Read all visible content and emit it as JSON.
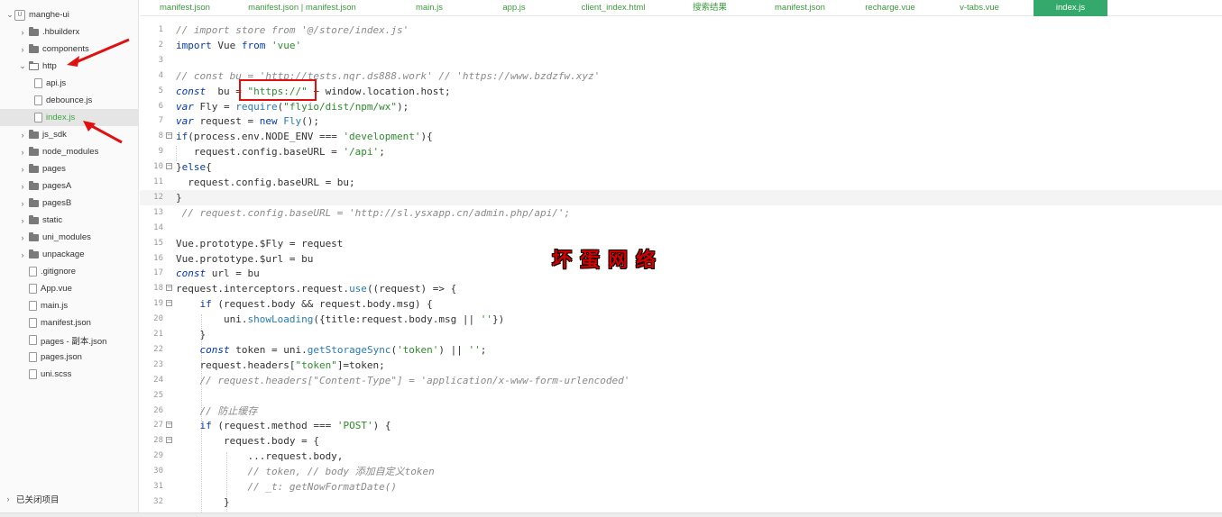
{
  "sidebar": {
    "items": [
      {
        "label": "manghe-ui",
        "type": "root",
        "chev": "⌄",
        "depth": 0
      },
      {
        "label": ".hbuilderx",
        "type": "folder",
        "chev": "›",
        "depth": 1
      },
      {
        "label": "components",
        "type": "folder",
        "chev": "›",
        "depth": 1
      },
      {
        "label": "http",
        "type": "folder-open",
        "chev": "⌄",
        "depth": 1
      },
      {
        "label": "api.js",
        "type": "file",
        "chev": "",
        "depth": 2
      },
      {
        "label": "debounce.js",
        "type": "file",
        "chev": "",
        "depth": 2
      },
      {
        "label": "index.js",
        "type": "file",
        "chev": "",
        "depth": 2,
        "active": true
      },
      {
        "label": "js_sdk",
        "type": "folder",
        "chev": "›",
        "depth": 1
      },
      {
        "label": "node_modules",
        "type": "folder",
        "chev": "›",
        "depth": 1
      },
      {
        "label": "pages",
        "type": "folder",
        "chev": "›",
        "depth": 1
      },
      {
        "label": "pagesA",
        "type": "folder",
        "chev": "›",
        "depth": 1
      },
      {
        "label": "pagesB",
        "type": "folder",
        "chev": "›",
        "depth": 1
      },
      {
        "label": "static",
        "type": "folder",
        "chev": "›",
        "depth": 1
      },
      {
        "label": "uni_modules",
        "type": "folder",
        "chev": "›",
        "depth": 1
      },
      {
        "label": "unpackage",
        "type": "folder",
        "chev": "›",
        "depth": 1
      },
      {
        "label": ".gitignore",
        "type": "file",
        "chev": "",
        "depth": 1
      },
      {
        "label": "App.vue",
        "type": "file",
        "chev": "",
        "depth": 1
      },
      {
        "label": "main.js",
        "type": "file",
        "chev": "",
        "depth": 1
      },
      {
        "label": "manifest.json",
        "type": "file",
        "chev": "",
        "depth": 1
      },
      {
        "label": "pages - 副本.json",
        "type": "file",
        "chev": "",
        "depth": 1
      },
      {
        "label": "pages.json",
        "type": "file",
        "chev": "",
        "depth": 1
      },
      {
        "label": "uni.scss",
        "type": "file",
        "chev": "",
        "depth": 1
      }
    ],
    "footer": "已关闭项目"
  },
  "tabs": [
    {
      "label": "manifest.json"
    },
    {
      "label": "manifest.json | manifest.json"
    },
    {
      "label": "main.js"
    },
    {
      "label": "app.js"
    },
    {
      "label": "client_index.html"
    },
    {
      "label": "搜索结果"
    },
    {
      "label": "manifest.json"
    },
    {
      "label": "recharge.vue"
    },
    {
      "label": "v-tabs.vue"
    },
    {
      "label": "index.js",
      "active": true
    }
  ],
  "watermark": "坏蛋网络",
  "code": {
    "lines": [
      {
        "n": "1",
        "fold": "",
        "tokens": [
          [
            "cm",
            "// import store from '@/store/index.js'"
          ]
        ]
      },
      {
        "n": "2",
        "fold": "",
        "tokens": [
          [
            "kw2",
            "import"
          ],
          [
            "",
            " Vue "
          ],
          [
            "kw2",
            "from"
          ],
          [
            "",
            " "
          ],
          [
            "str",
            "'vue'"
          ]
        ]
      },
      {
        "n": "3",
        "fold": "",
        "tokens": []
      },
      {
        "n": "4",
        "fold": "",
        "tokens": [
          [
            "cm",
            "// const bu = 'http://tests.nqr.ds888.work' // 'https://www.bzdzfw.xyz'"
          ]
        ]
      },
      {
        "n": "5",
        "fold": "",
        "tokens": [
          [
            "kw",
            "const"
          ],
          [
            "",
            "  bu = "
          ],
          [
            "str",
            "\"https://\""
          ],
          [
            "",
            " + window.location.host;"
          ]
        ]
      },
      {
        "n": "6",
        "fold": "",
        "tokens": [
          [
            "kw",
            "var"
          ],
          [
            "",
            " Fly = "
          ],
          [
            "fn",
            "require"
          ],
          [
            "",
            "("
          ],
          [
            "str",
            "\"flyio/dist/npm/wx\""
          ],
          [
            "",
            ");"
          ]
        ]
      },
      {
        "n": "7",
        "fold": "",
        "tokens": [
          [
            "kw",
            "var"
          ],
          [
            "",
            " request = "
          ],
          [
            "kw2",
            "new"
          ],
          [
            "",
            " "
          ],
          [
            "fn",
            "Fly"
          ],
          [
            "",
            "();"
          ]
        ]
      },
      {
        "n": "8",
        "fold": "−",
        "tokens": [
          [
            "kw2",
            "if"
          ],
          [
            "",
            "(process.env.NODE_ENV === "
          ],
          [
            "str",
            "'development'"
          ],
          [
            "",
            "){"
          ]
        ]
      },
      {
        "n": "9",
        "fold": "",
        "tokens": [
          [
            "",
            "   request.config.baseURL = "
          ],
          [
            "str",
            "'/api'"
          ],
          [
            "",
            ";"
          ]
        ]
      },
      {
        "n": "10",
        "fold": "−",
        "tokens": [
          [
            "",
            "}"
          ],
          [
            "kw2",
            "else"
          ],
          [
            "",
            "{"
          ]
        ]
      },
      {
        "n": "11",
        "fold": "",
        "tokens": [
          [
            "",
            "  request.config.baseURL = bu;"
          ]
        ]
      },
      {
        "n": "12",
        "fold": "",
        "tokens": [
          [
            "",
            "}"
          ]
        ],
        "hl": true
      },
      {
        "n": "13",
        "fold": "",
        "tokens": [
          [
            "cm",
            " // request.config.baseURL = 'http://sl.ysxapp.cn/admin.php/api/';"
          ]
        ]
      },
      {
        "n": "14",
        "fold": "",
        "tokens": []
      },
      {
        "n": "15",
        "fold": "",
        "tokens": [
          [
            "",
            "Vue.prototype.$Fly = request"
          ]
        ]
      },
      {
        "n": "16",
        "fold": "",
        "tokens": [
          [
            "",
            "Vue.prototype.$url = bu"
          ]
        ]
      },
      {
        "n": "17",
        "fold": "",
        "tokens": [
          [
            "kw",
            "const"
          ],
          [
            "",
            " url = bu"
          ]
        ]
      },
      {
        "n": "18",
        "fold": "−",
        "tokens": [
          [
            "",
            "request.interceptors.request."
          ],
          [
            "fn",
            "use"
          ],
          [
            "",
            "((request) => {"
          ]
        ]
      },
      {
        "n": "19",
        "fold": "−",
        "tokens": [
          [
            "",
            "    "
          ],
          [
            "kw2",
            "if"
          ],
          [
            "",
            " (request.body && request.body.msg) {"
          ]
        ]
      },
      {
        "n": "20",
        "fold": "",
        "tokens": [
          [
            "",
            "        uni."
          ],
          [
            "fn",
            "showLoading"
          ],
          [
            "",
            "({title:request.body.msg || "
          ],
          [
            "str",
            "''"
          ],
          [
            "",
            "})"
          ]
        ]
      },
      {
        "n": "21",
        "fold": "",
        "tokens": [
          [
            "",
            "    }"
          ]
        ]
      },
      {
        "n": "22",
        "fold": "",
        "tokens": [
          [
            "",
            "    "
          ],
          [
            "kw",
            "const"
          ],
          [
            "",
            " token = uni."
          ],
          [
            "fn",
            "getStorageSync"
          ],
          [
            "",
            "("
          ],
          [
            "str",
            "'token'"
          ],
          [
            "",
            ") || "
          ],
          [
            "str",
            "''"
          ],
          [
            "",
            ";"
          ]
        ]
      },
      {
        "n": "23",
        "fold": "",
        "tokens": [
          [
            "",
            "    request.headers["
          ],
          [
            "str",
            "\"token\""
          ],
          [
            "",
            "]=token;"
          ]
        ]
      },
      {
        "n": "24",
        "fold": "",
        "tokens": [
          [
            "cm",
            "    // request.headers[\"Content-Type\"] = 'application/x-www-form-urlencoded'"
          ]
        ]
      },
      {
        "n": "25",
        "fold": "",
        "tokens": []
      },
      {
        "n": "26",
        "fold": "",
        "tokens": [
          [
            "cm",
            "    // 防止缓存"
          ]
        ]
      },
      {
        "n": "27",
        "fold": "−",
        "tokens": [
          [
            "",
            "    "
          ],
          [
            "kw2",
            "if"
          ],
          [
            "",
            " (request.method === "
          ],
          [
            "str",
            "'POST'"
          ],
          [
            "",
            ") {"
          ]
        ]
      },
      {
        "n": "28",
        "fold": "−",
        "tokens": [
          [
            "",
            "        request.body = {"
          ]
        ]
      },
      {
        "n": "29",
        "fold": "",
        "tokens": [
          [
            "",
            "            ...request.body,"
          ]
        ]
      },
      {
        "n": "30",
        "fold": "",
        "tokens": [
          [
            "cm",
            "            // token, // body 添加自定义token"
          ]
        ]
      },
      {
        "n": "31",
        "fold": "",
        "tokens": [
          [
            "cm",
            "            // _t: getNowFormatDate()"
          ]
        ]
      },
      {
        "n": "32",
        "fold": "",
        "tokens": [
          [
            "",
            "        }"
          ]
        ]
      }
    ]
  }
}
